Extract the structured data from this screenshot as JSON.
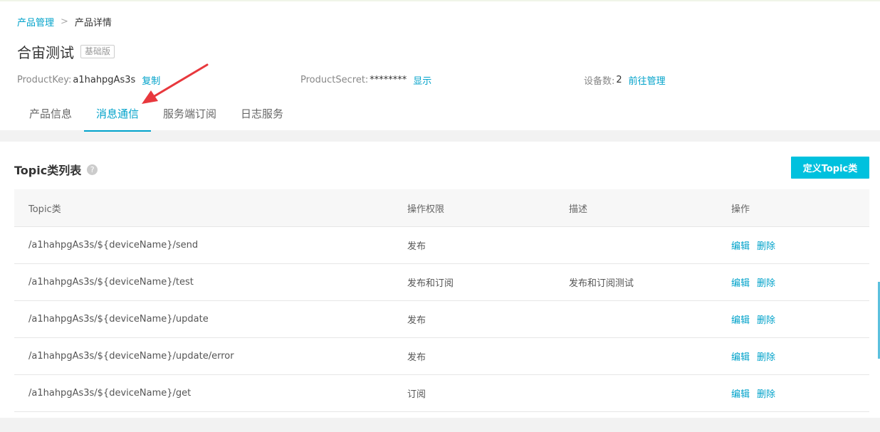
{
  "breadcrumb": {
    "parent": "产品管理",
    "separator": ">",
    "current": "产品详情"
  },
  "product": {
    "name": "合宙测试",
    "edition": "基础版"
  },
  "meta": {
    "product_key_label": "ProductKey:",
    "product_key_value": "a1hahpgAs3s",
    "copy_label": "复制",
    "product_secret_label": "ProductSecret:",
    "product_secret_value": "********",
    "show_label": "显示",
    "device_count_label": "设备数:",
    "device_count_value": "2",
    "manage_label": "前往管理"
  },
  "tabs": [
    {
      "label": "产品信息",
      "active": false
    },
    {
      "label": "消息通信",
      "active": true
    },
    {
      "label": "服务端订阅",
      "active": false
    },
    {
      "label": "日志服务",
      "active": false
    }
  ],
  "panel": {
    "title": "Topic类列表",
    "help_icon": "?",
    "define_button": "定义Topic类"
  },
  "table": {
    "columns": [
      "Topic类",
      "操作权限",
      "描述",
      "操作"
    ],
    "rows": [
      {
        "topic": "/a1hahpgAs3s/${deviceName}/send",
        "permission": "发布",
        "description": "",
        "edit": "编辑",
        "delete": "删除"
      },
      {
        "topic": "/a1hahpgAs3s/${deviceName}/test",
        "permission": "发布和订阅",
        "description": "发布和订阅测试",
        "edit": "编辑",
        "delete": "删除"
      },
      {
        "topic": "/a1hahpgAs3s/${deviceName}/update",
        "permission": "发布",
        "description": "",
        "edit": "编辑",
        "delete": "删除"
      },
      {
        "topic": "/a1hahpgAs3s/${deviceName}/update/error",
        "permission": "发布",
        "description": "",
        "edit": "编辑",
        "delete": "删除"
      },
      {
        "topic": "/a1hahpgAs3s/${deviceName}/get",
        "permission": "订阅",
        "description": "",
        "edit": "编辑",
        "delete": "删除"
      }
    ]
  },
  "colors": {
    "accent": "#00a2ca",
    "button": "#00c1de",
    "arrow": "#e8383d"
  }
}
